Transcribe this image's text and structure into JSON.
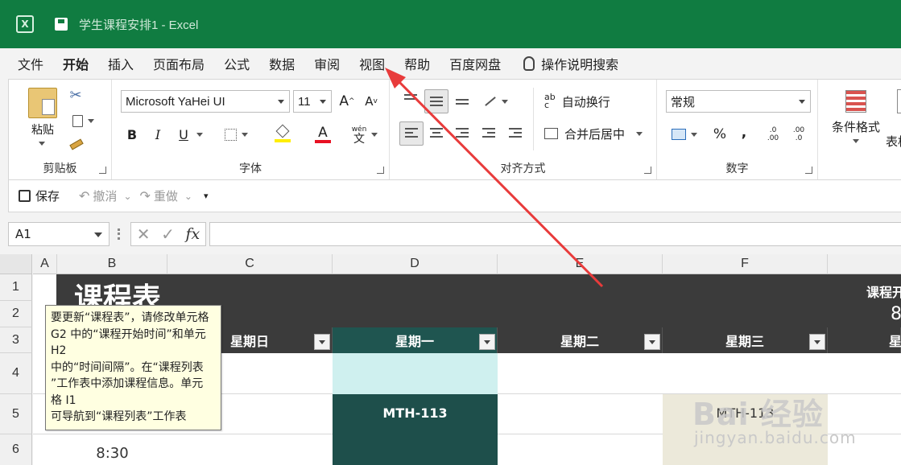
{
  "titlebar": {
    "title": "学生课程安排1 - Excel",
    "app_icon": "X"
  },
  "menu": {
    "items": [
      "文件",
      "开始",
      "插入",
      "页面布局",
      "公式",
      "数据",
      "审阅",
      "视图",
      "帮助",
      "百度网盘"
    ],
    "active": "开始",
    "search_label": "操作说明搜索"
  },
  "ribbon": {
    "clipboard": {
      "paste": "粘贴",
      "label": "剪贴板"
    },
    "font": {
      "name": "Microsoft YaHei UI",
      "size": "11",
      "bold": "B",
      "italic": "I",
      "underline": "U",
      "grow": "A",
      "shrink": "A",
      "color_a": "A",
      "pinyin_top": "wén",
      "pinyin_char": "文",
      "label": "字体",
      "highlight_color": "#ffee00",
      "font_color": "#e81123"
    },
    "alignment": {
      "wrap": "自动换行",
      "merge": "合并后居中",
      "label": "对齐方式",
      "wrap_glyph": "ab",
      "wrap_glyph2": "c"
    },
    "number": {
      "format": "常规",
      "percent": "%",
      "comma": "9",
      "inc": ".0",
      "inc2": ".00",
      "dec": ".00",
      "dec2": ".0",
      "label": "数字"
    },
    "styles": {
      "conditional": "条件格式",
      "table_fmt": "表格"
    }
  },
  "qat": {
    "save": "保存",
    "undo": "撤消",
    "redo": "重做"
  },
  "formula_bar": {
    "name_box": "A1",
    "fx": "fx",
    "cancel": "✕",
    "confirm": "✓"
  },
  "columns": [
    "A",
    "B",
    "C",
    "D",
    "E",
    "F"
  ],
  "rows": [
    "1",
    "2",
    "3",
    "4",
    "5",
    "6"
  ],
  "sheet": {
    "title": "课程表",
    "right_label": "课程开",
    "right_value": "8",
    "days": [
      "星期日",
      "星期一",
      "星期二",
      "星期三",
      "星"
    ],
    "course_mon": "MTH-113",
    "course_wed": "MTH-113",
    "time": "8:30",
    "colors": {
      "banner": "#3b3b3b",
      "monday_header": "#1f5550",
      "monday_light": "#cff0ef",
      "course_dark": "#1e4f4b",
      "course_beige": "#ece9da"
    }
  },
  "tooltip": {
    "lines": [
      "要更新“课程表”，请修改单元格",
      "G2 中的“课程开始时间”和单元",
      "H2",
      "中的“时间间隔”。在“课程列表",
      "”工作表中添加课程信息。单元",
      "格 I1",
      "可导航到“课程列表”工作表"
    ]
  },
  "watermark": {
    "brand": "Bai 经验",
    "url": "jingyan.baidu.com"
  }
}
